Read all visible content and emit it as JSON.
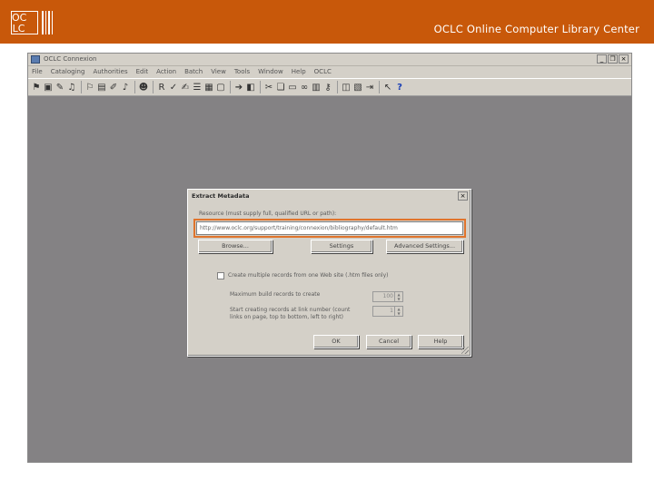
{
  "slide": {
    "logo": {
      "letters": [
        "OC",
        "LC"
      ]
    },
    "header_text": "OCLC Online Computer Library Center",
    "accent_color": "#c8580a"
  },
  "app": {
    "title": "OCLC Connexion",
    "window_controls": [
      "_",
      "❐",
      "×"
    ],
    "menu": [
      "File",
      "Cataloging",
      "Authorities",
      "Edit",
      "Action",
      "Batch",
      "View",
      "Tools",
      "Window",
      "Help",
      "OCLC"
    ],
    "toolbar_icons": [
      "record-icon",
      "bib-icon",
      "edit-icon",
      "save-icon",
      "auth-icon",
      "flag-icon",
      "auth-edit-icon",
      "auth-save-icon",
      "users-icon",
      "bracket-r-icon",
      "validate-icon",
      "edit-doc-icon",
      "list-icon",
      "list-save-icon",
      "window-icon",
      "arrow-right-icon",
      "tag-icon",
      "pin-icon",
      "copy-icon",
      "paste-icon",
      "binoculars-icon",
      "books-icon",
      "key-icon",
      "bib-view-icon",
      "marc-view-icon",
      "rotate-icon",
      "question-icon",
      "help-icon"
    ]
  },
  "dialog": {
    "title": "Extract Metadata",
    "resource_label": "Resource (must supply full, qualified URL or path):",
    "resource_value": "http://www.oclc.org/support/training/connexion/bibliography/default.htm",
    "buttons": {
      "browse": "Browse...",
      "settings": "Settings",
      "advanced": "Advanced Settings...",
      "ok": "OK",
      "cancel": "Cancel",
      "help": "Help"
    },
    "multiple_records_label": "Create multiple records from one Web site (.htm files only)",
    "max_records_label": "Maximum build records to create",
    "max_records_value": "100",
    "start_label_line1": "Start creating records at link number (count",
    "start_label_line2": "links on page, top to bottom, left to right)",
    "start_value": "1"
  }
}
